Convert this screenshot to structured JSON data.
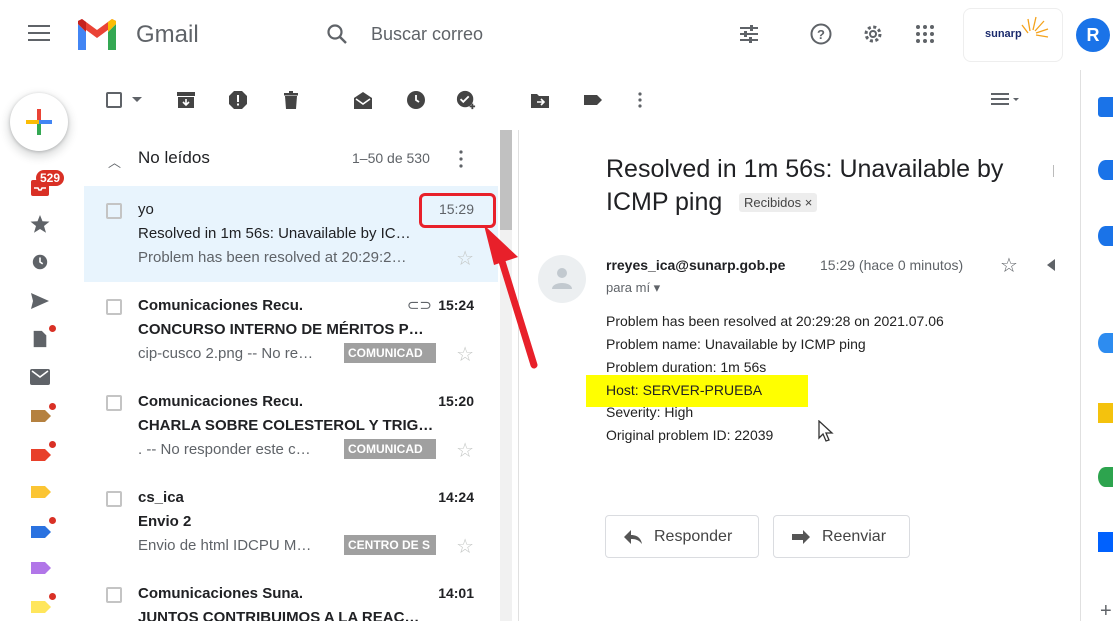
{
  "header": {
    "app_name": "Gmail",
    "search_placeholder": "Buscar correo",
    "org_logo_text": "sunarp",
    "avatar_letter": "R"
  },
  "left_rail": {
    "unread_badge": "529"
  },
  "list": {
    "section_title": "No leídos",
    "count": "1–50 de 530",
    "rows": [
      {
        "sender": "yo",
        "time": "15:29",
        "subject": "Resolved in 1m 56s: Unavailable by IC…",
        "snippet": "Problem has been resolved at 20:29:2…",
        "tag": "",
        "unread": false,
        "selected": true
      },
      {
        "sender": "Comunicaciones Recu.",
        "time": "15:24",
        "subject": "CONCURSO INTERNO DE MÉRITOS P…",
        "snippet": "cip-cusco 2.png -- No re…",
        "tag": "COMUNICAD",
        "unread": true,
        "attachment": true
      },
      {
        "sender": "Comunicaciones Recu.",
        "time": "15:20",
        "subject": "CHARLA SOBRE COLESTEROL Y TRIG…",
        "snippet": ". -- No responder este c…",
        "tag": "COMUNICAD",
        "unread": true
      },
      {
        "sender": "cs_ica",
        "time": "14:24",
        "subject": "Envio 2",
        "snippet": "Envio de html IDCPU M…",
        "tag": "CENTRO DE S",
        "unread": true
      },
      {
        "sender": "Comunicaciones Suna.",
        "time": "14:01",
        "subject": "JUNTOS CONTRIBUIMOS A LA REAC…",
        "snippet": "",
        "tag": "",
        "unread": true
      }
    ]
  },
  "message": {
    "subject": "Resolved in 1m 56s: Unavailable by ICMP ping",
    "inbox_chip": "Recibidos ×",
    "from": "rreyes_ica@sunarp.gob.pe",
    "time": "15:29 (hace 0 minutos)",
    "to": "para mí ▾",
    "body": [
      "Problem has been resolved at 20:29:28 on 2021.07.06",
      "Problem name: Unavailable by ICMP ping",
      "Problem duration: 1m 56s",
      "Host: SERVER-PRUEBA",
      "Severity: High",
      "Original problem ID: 22039"
    ],
    "reply_label": "Responder",
    "forward_label": "Reenviar"
  },
  "colors": {
    "highlight": "#ffff00",
    "annotation_red": "#e8202a",
    "selected_row": "#e8f4fd"
  }
}
